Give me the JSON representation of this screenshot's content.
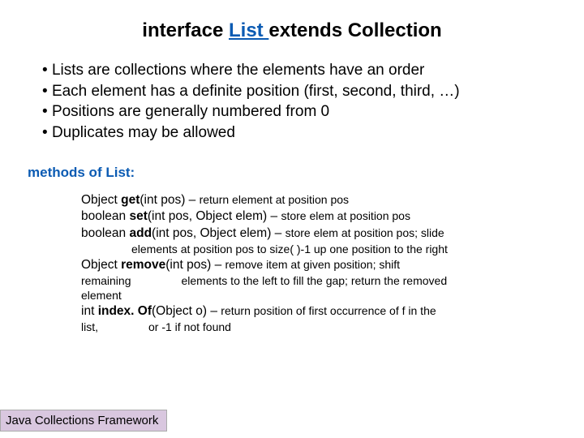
{
  "title": {
    "pre": "interface ",
    "keyword": "List ",
    "post": "extends Collection"
  },
  "bullets": [
    "Lists are collections where the elements have an order",
    "Each element has a definite position (first, second, third, …)",
    "Positions are generally numbered from 0",
    "Duplicates may be allowed"
  ],
  "section_heading": "methods of List:",
  "methods": {
    "get": {
      "ret": "Object ",
      "name": "get",
      "params": "(int pos) – ",
      "desc": "return element at position pos"
    },
    "set": {
      "ret": "boolean ",
      "name": "set",
      "params": "(int pos, Object elem) – ",
      "desc": "store elem at position pos"
    },
    "add": {
      "ret": "boolean ",
      "name": "add",
      "params": "(int pos, Object elem) – ",
      "desc": "store elem at position pos; slide",
      "cont": "elements at position pos to size( )-1 up one position to the right"
    },
    "remove": {
      "ret": "Object ",
      "name": "remove",
      "params": "(int pos) – ",
      "desc": "remove item at given position; shift",
      "cont1_a": "remaining",
      "cont1_b": "elements to the left to fill the gap; return the removed",
      "cont2": "element"
    },
    "indexof": {
      "ret": "int ",
      "name": "index. Of",
      "params": "(Object o) – ",
      "desc": "return position of first occurrence of f in the",
      "cont_a": "list,",
      "cont_b": "or -1 if not found"
    }
  },
  "footer": "Java Collections Framework"
}
